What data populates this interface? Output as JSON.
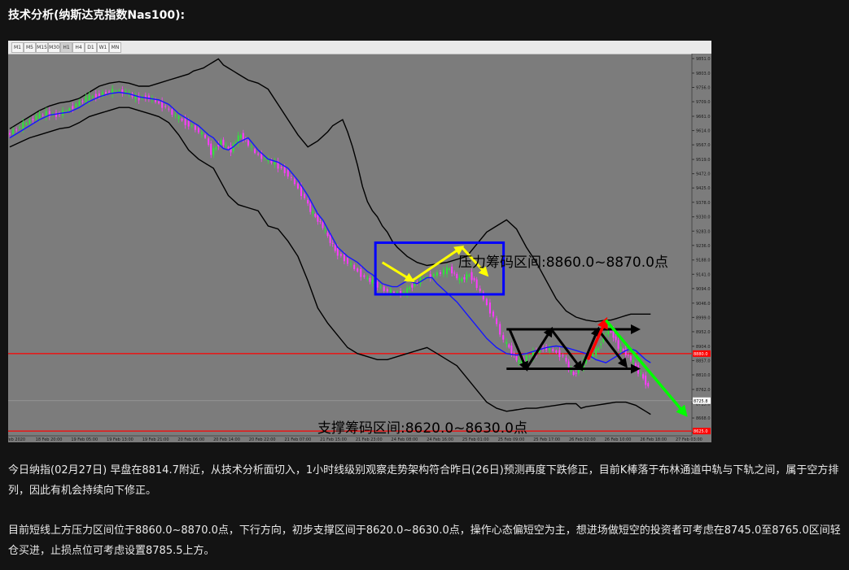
{
  "page": {
    "heading": "技术分析(纳斯达克指数Nas100):",
    "paragraph_1": "今日纳指(02月27日) 早盘在8814.7附近，从技术分析面切入，1小时线级别观察走势架构符合昨日(26日)预测再度下跌修正，目前K棒落于布林通道中轨与下轨之间，属于空方排列，因此有机会持续向下修正。",
    "paragraph_2": "目前短线上方压力区间位于8860.0~8870.0点，下行方向，初步支撑区间于8620.0~8630.0点，操作心态偏短空为主，想进场做短空的投资者可考虑在8745.0至8765.0区间轻仓买进，止损点位可考虑设置8785.5上方。"
  },
  "toolbar": {
    "timeframes": [
      "M1",
      "M5",
      "M15",
      "M30",
      "H1",
      "H4",
      "D1",
      "W1",
      "MN"
    ],
    "active": "H1"
  },
  "colors": {
    "background": "#7c7c7c",
    "bull_candle": "#2fe63a",
    "bear_candle": "#ff3aff",
    "middle_band": "#1616ff",
    "outer_band": "#000000",
    "red_line": "#ff0000",
    "box": "#0000ff",
    "yellow_arrow": "#ffff00",
    "green_arrow": "#00ff00",
    "red_arrow": "#ff0000"
  },
  "chart_data": {
    "type": "line",
    "title": "",
    "xlabel": "",
    "ylabel": "",
    "ylim": [
      8620,
      9851
    ],
    "y_ticks": [
      "9851.0",
      "9803.0",
      "9756.0",
      "9709.0",
      "9661.0",
      "9614.0",
      "9567.0",
      "9519.0",
      "9472.0",
      "9425.0",
      "9378.0",
      "9330.0",
      "9283.0",
      "9236.0",
      "9188.0",
      "9141.0",
      "9094.0",
      "9046.0",
      "8999.0",
      "8952.0",
      "8904.0",
      "8857.0",
      "8810.0",
      "8762.0",
      "8715.0",
      "8668.0",
      "8620.0"
    ],
    "x_ticks": [
      "18 Feb 2020",
      "18 Feb 20:00",
      "19 Feb 05:00",
      "19 Feb 13:00",
      "19 Feb 21:00",
      "20 Feb 06:00",
      "20 Feb 14:00",
      "20 Feb 22:00",
      "21 Feb 07:00",
      "21 Feb 15:00",
      "21 Feb 23:00",
      "24 Feb 08:00",
      "24 Feb 16:00",
      "25 Feb 01:00",
      "25 Feb 09:00",
      "25 Feb 17:00",
      "26 Feb 02:00",
      "26 Feb 10:00",
      "26 Feb 18:00",
      "27 Feb 03:00"
    ],
    "price_labels": {
      "current": {
        "value": 8880.0,
        "text": "8880.0"
      },
      "last": {
        "value": 8725.0,
        "text": "8725.8"
      },
      "lower_red": {
        "value": 8625.0,
        "text": "8625.0"
      }
    },
    "annotations": {
      "resistance": "压力筹码区间:8860.0~8870.0点",
      "support": "支撑筹码区间:8620.0~8630.0点"
    },
    "series": [
      {
        "role": "middle",
        "x": [
          0,
          10,
          20,
          30,
          40,
          50,
          60,
          70,
          80,
          90,
          100,
          110,
          120,
          130,
          140,
          150,
          160,
          170,
          180,
          190,
          200,
          205,
          210,
          215,
          220,
          225,
          230,
          240,
          250,
          260,
          270,
          280,
          290,
          300,
          305,
          310,
          315,
          320,
          325,
          330,
          340,
          350,
          360,
          365,
          370,
          375,
          380,
          385,
          390,
          395,
          400,
          405,
          410,
          415,
          420,
          425,
          430,
          440,
          450,
          460,
          470,
          480,
          490,
          500,
          510,
          520,
          530,
          540,
          550,
          560,
          570,
          580,
          590,
          600,
          605,
          610,
          615,
          620,
          625,
          630,
          635,
          640,
          645
        ],
        "y": [
          9590,
          9610,
          9630,
          9650,
          9665,
          9670,
          9675,
          9690,
          9710,
          9725,
          9735,
          9740,
          9735,
          9725,
          9720,
          9715,
          9700,
          9670,
          9650,
          9630,
          9600,
          9590,
          9570,
          9555,
          9550,
          9560,
          9575,
          9590,
          9550,
          9520,
          9510,
          9490,
          9450,
          9400,
          9370,
          9340,
          9320,
          9290,
          9260,
          9230,
          9200,
          9180,
          9150,
          9140,
          9125,
          9110,
          9105,
          9100,
          9100,
          9110,
          9120,
          9115,
          9110,
          9120,
          9130,
          9130,
          9110,
          9080,
          9050,
          9010,
          8970,
          8930,
          8900,
          8880,
          8875,
          8880,
          8890,
          8900,
          8905,
          8900,
          8890,
          8880,
          8860,
          8850,
          8860,
          8870,
          8880,
          8890,
          8895,
          8890,
          8875,
          8860,
          8850
        ]
      },
      {
        "role": "upper",
        "x": [
          0,
          10,
          20,
          30,
          40,
          50,
          60,
          70,
          80,
          90,
          100,
          110,
          120,
          130,
          140,
          150,
          160,
          170,
          180,
          185,
          190,
          195,
          200,
          205,
          210,
          215,
          220,
          225,
          230,
          240,
          250,
          260,
          270,
          280,
          290,
          300,
          310,
          320,
          325,
          330,
          335,
          340,
          345,
          350,
          355,
          360,
          365,
          370,
          375,
          380,
          385,
          390,
          400,
          410,
          420,
          430,
          440,
          450,
          460,
          470,
          480,
          490,
          500,
          510,
          520,
          530,
          540,
          550,
          560,
          570,
          580,
          590,
          600,
          605,
          610,
          615,
          620,
          625,
          630,
          635,
          640,
          645
        ],
        "y": [
          9620,
          9640,
          9660,
          9680,
          9695,
          9705,
          9710,
          9720,
          9740,
          9760,
          9770,
          9775,
          9770,
          9760,
          9760,
          9770,
          9780,
          9790,
          9800,
          9810,
          9815,
          9820,
          9830,
          9840,
          9850,
          9830,
          9820,
          9810,
          9800,
          9780,
          9770,
          9750,
          9700,
          9650,
          9600,
          9560,
          9580,
          9610,
          9630,
          9640,
          9650,
          9610,
          9560,
          9500,
          9430,
          9380,
          9350,
          9330,
          9300,
          9280,
          9250,
          9230,
          9200,
          9180,
          9170,
          9175,
          9180,
          9190,
          9200,
          9240,
          9280,
          9300,
          9320,
          9290,
          9230,
          9180,
          9120,
          9060,
          9020,
          9000,
          8990,
          8985,
          8990,
          8990,
          8995,
          9000,
          9005,
          9010,
          9010,
          9010,
          9010,
          9010
        ]
      },
      {
        "role": "lower",
        "x": [
          0,
          10,
          20,
          30,
          40,
          50,
          60,
          70,
          80,
          90,
          100,
          110,
          120,
          130,
          140,
          150,
          160,
          170,
          180,
          190,
          200,
          205,
          210,
          220,
          230,
          240,
          250,
          260,
          270,
          280,
          290,
          300,
          310,
          320,
          330,
          340,
          350,
          360,
          370,
          380,
          390,
          400,
          410,
          420,
          430,
          440,
          450,
          460,
          470,
          480,
          490,
          500,
          510,
          520,
          530,
          540,
          550,
          560,
          570,
          575,
          580,
          590,
          600,
          610,
          620,
          630,
          635,
          640,
          645
        ],
        "y": [
          9560,
          9575,
          9590,
          9600,
          9610,
          9620,
          9625,
          9640,
          9660,
          9670,
          9680,
          9690,
          9690,
          9680,
          9670,
          9660,
          9640,
          9600,
          9550,
          9520,
          9500,
          9490,
          9460,
          9400,
          9370,
          9360,
          9350,
          9300,
          9290,
          9250,
          9200,
          9120,
          9030,
          8980,
          8940,
          8900,
          8880,
          8870,
          8860,
          8860,
          8870,
          8880,
          8890,
          8900,
          8880,
          8860,
          8840,
          8800,
          8760,
          8720,
          8700,
          8690,
          8695,
          8700,
          8700,
          8705,
          8710,
          8715,
          8715,
          8700,
          8705,
          8710,
          8715,
          8720,
          8720,
          8710,
          8700,
          8690,
          8680
        ]
      },
      {
        "role": "price",
        "x": [
          0,
          10,
          20,
          30,
          40,
          50,
          60,
          70,
          80,
          90,
          100,
          110,
          120,
          130,
          140,
          150,
          160,
          170,
          180,
          190,
          200,
          205,
          210,
          215,
          220,
          225,
          230,
          235,
          240,
          250,
          260,
          270,
          280,
          290,
          300,
          305,
          310,
          315,
          320,
          325,
          330,
          340,
          350,
          360,
          365,
          370,
          380,
          390,
          400,
          405,
          410,
          420,
          430,
          440,
          445,
          450,
          455,
          460,
          465,
          470,
          480,
          490,
          500,
          505,
          510,
          515,
          520,
          530,
          540,
          550,
          560,
          565,
          570,
          575,
          580,
          590,
          595,
          600,
          605,
          610,
          615,
          620,
          625,
          630,
          635,
          640,
          645
        ],
        "y": [
          9600,
          9620,
          9640,
          9660,
          9670,
          9665,
          9680,
          9700,
          9720,
          9730,
          9740,
          9745,
          9740,
          9720,
          9725,
          9710,
          9690,
          9660,
          9640,
          9620,
          9590,
          9540,
          9560,
          9580,
          9560,
          9550,
          9580,
          9600,
          9580,
          9540,
          9520,
          9505,
          9480,
          9440,
          9390,
          9350,
          9330,
          9310,
          9280,
          9250,
          9220,
          9190,
          9160,
          9130,
          9120,
          9110,
          9090,
          9080,
          9080,
          9100,
          9110,
          9130,
          9140,
          9150,
          9160,
          9140,
          9120,
          9130,
          9140,
          9120,
          9060,
          9000,
          8920,
          8900,
          8870,
          8850,
          8860,
          8880,
          8900,
          8890,
          8870,
          8830,
          8810,
          8830,
          8850,
          8880,
          8900,
          8940,
          8960,
          8940,
          8900,
          8890,
          8870,
          8850,
          8820,
          8800,
          8770
        ]
      }
    ],
    "arrows": [
      {
        "color": "yellow",
        "points": [
          [
            375,
            9180
          ],
          [
            405,
            9120
          ],
          [
            435,
            9170
          ],
          [
            455,
            9230
          ],
          [
            475,
            9160
          ],
          [
            480,
            9140
          ]
        ]
      },
      {
        "color": "black",
        "points": [
          [
            0,
            8960
          ],
          [
            125,
            8960
          ]
        ],
        "role": "upper-channel"
      },
      {
        "color": "black",
        "points": [
          [
            0,
            8830
          ],
          [
            125,
            8830
          ]
        ],
        "role": "lower-channel"
      },
      {
        "color": "red",
        "points": [
          [
            582,
            8860
          ],
          [
            600,
            8990
          ]
        ]
      },
      {
        "color": "green",
        "points": [
          [
            600,
            8990
          ],
          [
            680,
            8680
          ]
        ]
      }
    ]
  }
}
